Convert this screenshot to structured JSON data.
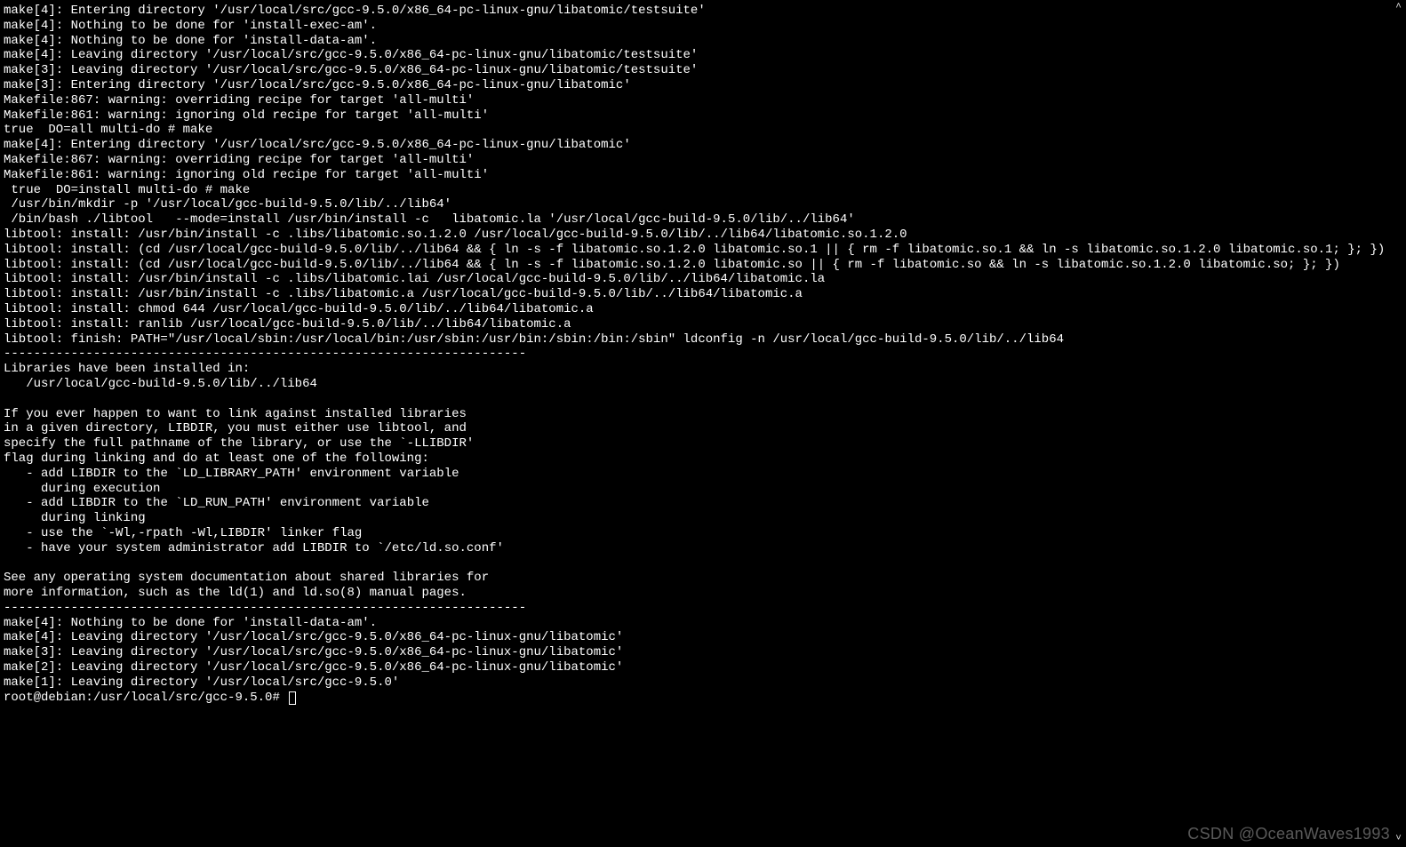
{
  "terminal": {
    "lines": [
      "make[4]: Entering directory '/usr/local/src/gcc-9.5.0/x86_64-pc-linux-gnu/libatomic/testsuite'",
      "make[4]: Nothing to be done for 'install-exec-am'.",
      "make[4]: Nothing to be done for 'install-data-am'.",
      "make[4]: Leaving directory '/usr/local/src/gcc-9.5.0/x86_64-pc-linux-gnu/libatomic/testsuite'",
      "make[3]: Leaving directory '/usr/local/src/gcc-9.5.0/x86_64-pc-linux-gnu/libatomic/testsuite'",
      "make[3]: Entering directory '/usr/local/src/gcc-9.5.0/x86_64-pc-linux-gnu/libatomic'",
      "Makefile:867: warning: overriding recipe for target 'all-multi'",
      "Makefile:861: warning: ignoring old recipe for target 'all-multi'",
      "true  DO=all multi-do # make",
      "make[4]: Entering directory '/usr/local/src/gcc-9.5.0/x86_64-pc-linux-gnu/libatomic'",
      "Makefile:867: warning: overriding recipe for target 'all-multi'",
      "Makefile:861: warning: ignoring old recipe for target 'all-multi'",
      " true  DO=install multi-do # make",
      " /usr/bin/mkdir -p '/usr/local/gcc-build-9.5.0/lib/../lib64'",
      " /bin/bash ./libtool   --mode=install /usr/bin/install -c   libatomic.la '/usr/local/gcc-build-9.5.0/lib/../lib64'",
      "libtool: install: /usr/bin/install -c .libs/libatomic.so.1.2.0 /usr/local/gcc-build-9.5.0/lib/../lib64/libatomic.so.1.2.0",
      "libtool: install: (cd /usr/local/gcc-build-9.5.0/lib/../lib64 && { ln -s -f libatomic.so.1.2.0 libatomic.so.1 || { rm -f libatomic.so.1 && ln -s libatomic.so.1.2.0 libatomic.so.1; }; })",
      "libtool: install: (cd /usr/local/gcc-build-9.5.0/lib/../lib64 && { ln -s -f libatomic.so.1.2.0 libatomic.so || { rm -f libatomic.so && ln -s libatomic.so.1.2.0 libatomic.so; }; })",
      "libtool: install: /usr/bin/install -c .libs/libatomic.lai /usr/local/gcc-build-9.5.0/lib/../lib64/libatomic.la",
      "libtool: install: /usr/bin/install -c .libs/libatomic.a /usr/local/gcc-build-9.5.0/lib/../lib64/libatomic.a",
      "libtool: install: chmod 644 /usr/local/gcc-build-9.5.0/lib/../lib64/libatomic.a",
      "libtool: install: ranlib /usr/local/gcc-build-9.5.0/lib/../lib64/libatomic.a",
      "libtool: finish: PATH=\"/usr/local/sbin:/usr/local/bin:/usr/sbin:/usr/bin:/sbin:/bin:/sbin\" ldconfig -n /usr/local/gcc-build-9.5.0/lib/../lib64",
      "----------------------------------------------------------------------",
      "Libraries have been installed in:",
      "   /usr/local/gcc-build-9.5.0/lib/../lib64",
      "",
      "If you ever happen to want to link against installed libraries",
      "in a given directory, LIBDIR, you must either use libtool, and",
      "specify the full pathname of the library, or use the `-LLIBDIR'",
      "flag during linking and do at least one of the following:",
      "   - add LIBDIR to the `LD_LIBRARY_PATH' environment variable",
      "     during execution",
      "   - add LIBDIR to the `LD_RUN_PATH' environment variable",
      "     during linking",
      "   - use the `-Wl,-rpath -Wl,LIBDIR' linker flag",
      "   - have your system administrator add LIBDIR to `/etc/ld.so.conf'",
      "",
      "See any operating system documentation about shared libraries for",
      "more information, such as the ld(1) and ld.so(8) manual pages.",
      "----------------------------------------------------------------------",
      "make[4]: Nothing to be done for 'install-data-am'.",
      "make[4]: Leaving directory '/usr/local/src/gcc-9.5.0/x86_64-pc-linux-gnu/libatomic'",
      "make[3]: Leaving directory '/usr/local/src/gcc-9.5.0/x86_64-pc-linux-gnu/libatomic'",
      "make[2]: Leaving directory '/usr/local/src/gcc-9.5.0/x86_64-pc-linux-gnu/libatomic'",
      "make[1]: Leaving directory '/usr/local/src/gcc-9.5.0'"
    ],
    "prompt": "root@debian:/usr/local/src/gcc-9.5.0# "
  },
  "watermark": "CSDN @OceanWaves1993",
  "scroll": {
    "up": "˄",
    "down": "˅"
  }
}
